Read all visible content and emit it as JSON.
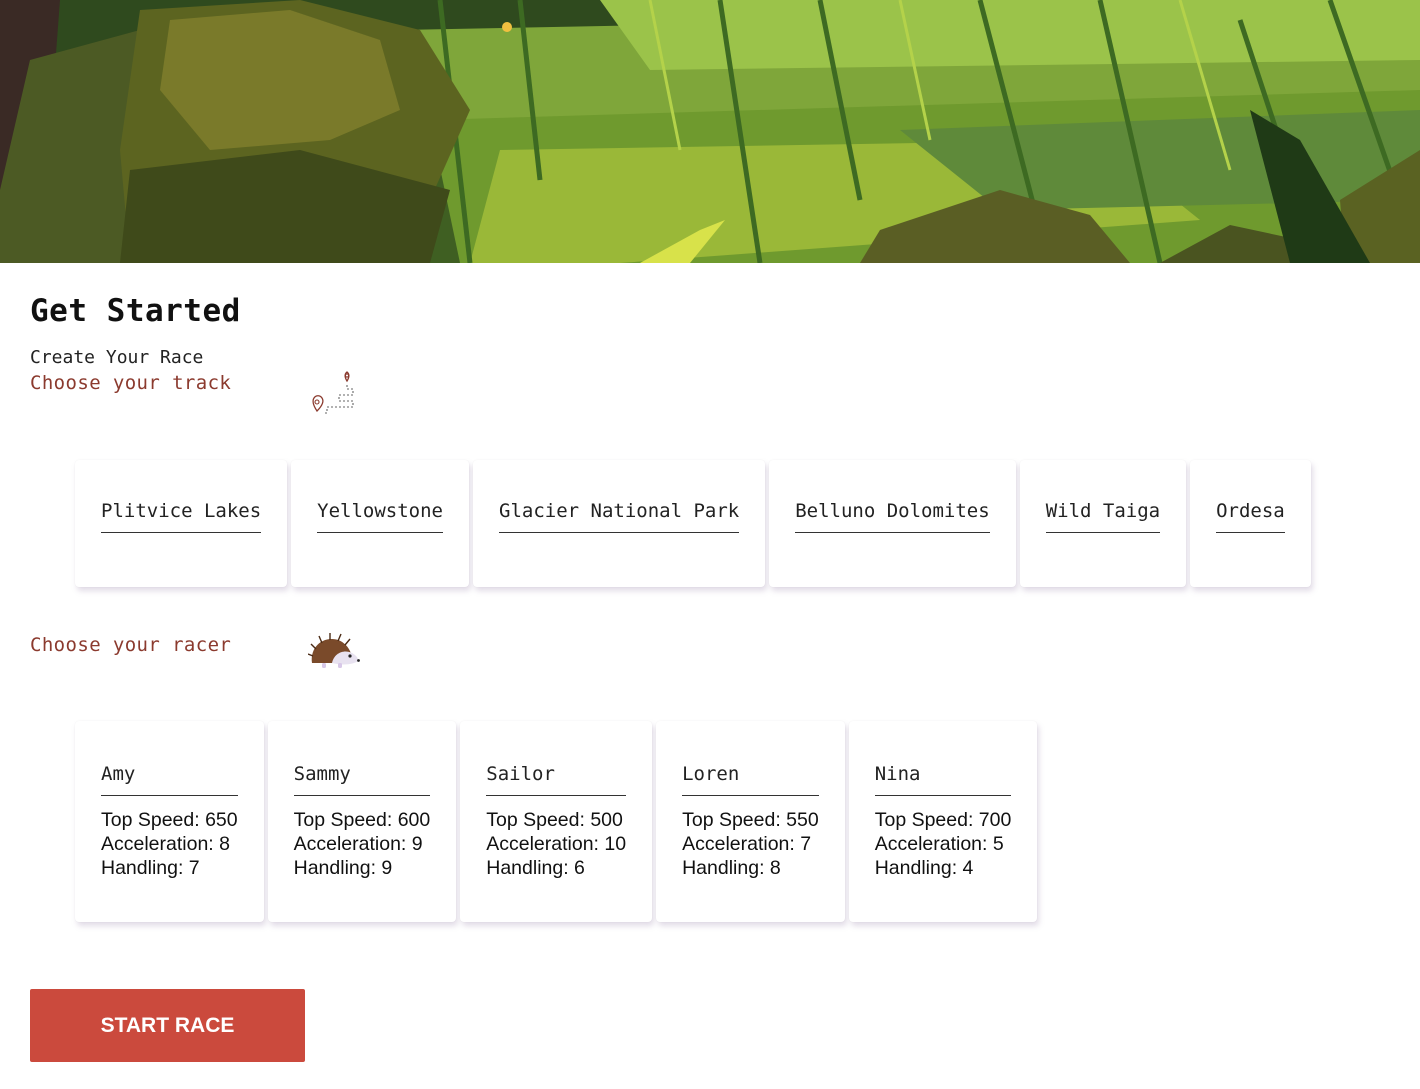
{
  "header": {
    "banner_image": "forest-swamp-illustration"
  },
  "page": {
    "title": "Get Started",
    "subtitle": "Create Your Race"
  },
  "track_section": {
    "label": "Choose your track",
    "icon": "route-map-pin-icon",
    "tracks": [
      {
        "name": "Plitvice Lakes"
      },
      {
        "name": "Yellowstone"
      },
      {
        "name": "Glacier National Park"
      },
      {
        "name": "Belluno Dolomites"
      },
      {
        "name": "Wild Taiga"
      },
      {
        "name": "Ordesa"
      }
    ]
  },
  "racer_section": {
    "label": "Choose your racer",
    "icon": "hedgehog-icon",
    "racers": [
      {
        "name": "Amy",
        "top_speed": "Top Speed: 650",
        "acceleration": "Acceleration: 8",
        "handling": "Handling: 7"
      },
      {
        "name": "Sammy",
        "top_speed": "Top Speed: 600",
        "acceleration": "Acceleration: 9",
        "handling": "Handling: 9"
      },
      {
        "name": "Sailor",
        "top_speed": "Top Speed: 500",
        "acceleration": "Acceleration: 10",
        "handling": "Handling: 6"
      },
      {
        "name": "Loren",
        "top_speed": "Top Speed: 550",
        "acceleration": "Acceleration: 7",
        "handling": "Handling: 8"
      },
      {
        "name": "Nina",
        "top_speed": "Top Speed: 700",
        "acceleration": "Acceleration: 5",
        "handling": "Handling: 4"
      }
    ]
  },
  "actions": {
    "start_label": "START RACE"
  },
  "colors": {
    "accent": "#8b3a2e",
    "button": "#cb4a3d"
  }
}
